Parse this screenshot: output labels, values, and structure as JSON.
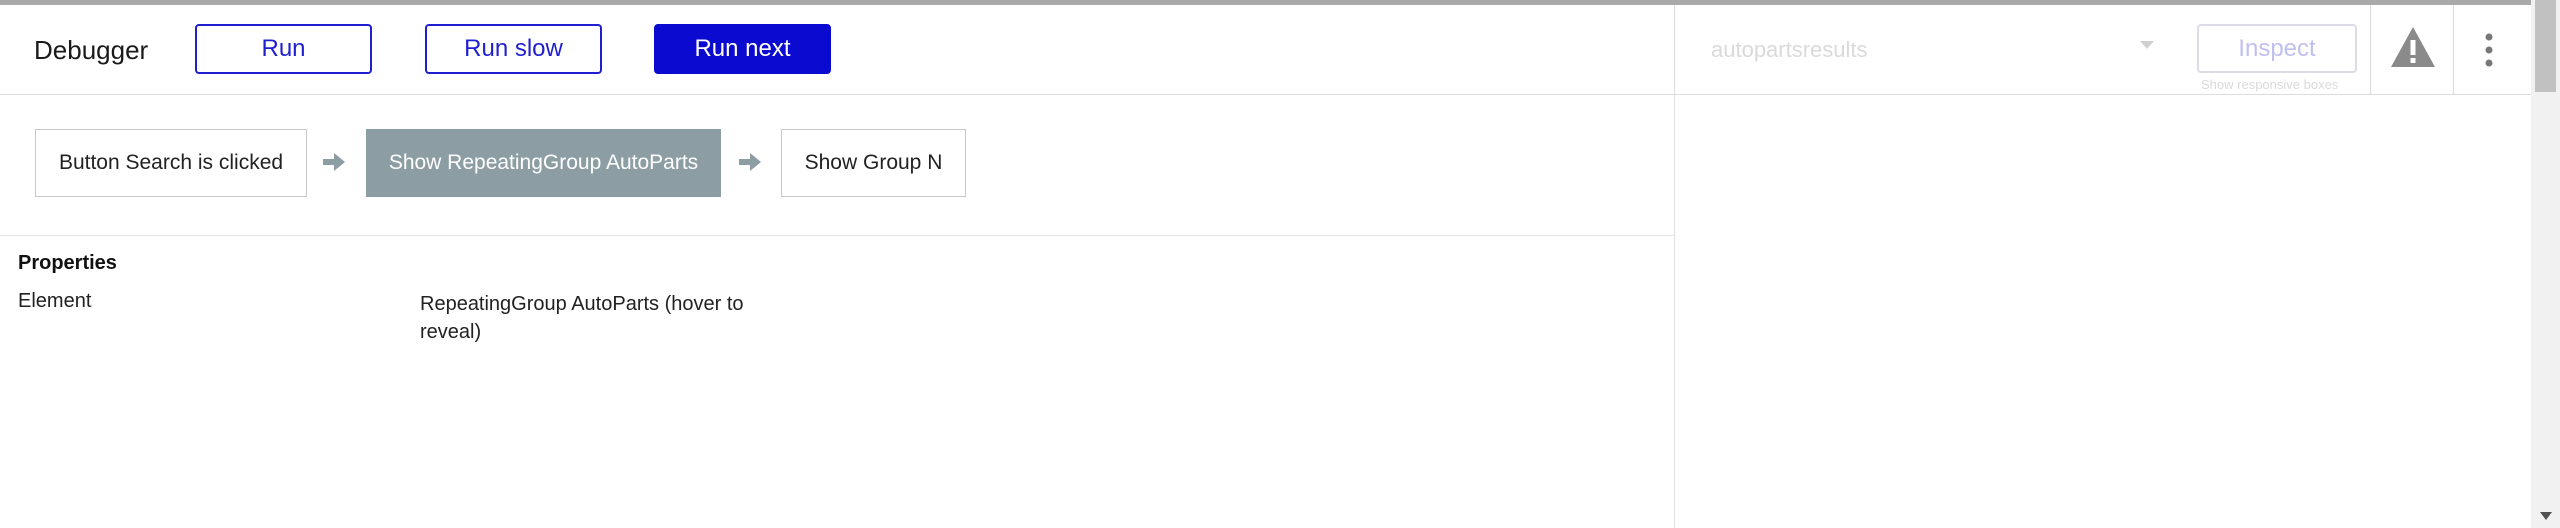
{
  "header": {
    "title": "Debugger",
    "run_label": "Run",
    "run_slow_label": "Run slow",
    "run_next_label": "Run next",
    "element_dropdown_value": "autopartsresults",
    "inspect_label": "Inspect",
    "inspect_note": "Show responsive boxes",
    "warning_icon": "warning-triangle-icon",
    "menu_icon": "vertical-dots-icon"
  },
  "workflow": {
    "steps": [
      {
        "label": "Button Search is clicked",
        "active": false
      },
      {
        "label": "Show RepeatingGroup AutoParts",
        "active": true
      },
      {
        "label": "Show Group N",
        "active": false
      }
    ],
    "arrow_icon": "arrow-right-icon"
  },
  "properties": {
    "title": "Properties",
    "rows": [
      {
        "key": "Element",
        "value": "RepeatingGroup AutoParts (hover to reveal)"
      }
    ]
  },
  "colors": {
    "primary": "#0a0ad0",
    "active_step": "#8c9da3",
    "disabled_text": "#dadada"
  }
}
